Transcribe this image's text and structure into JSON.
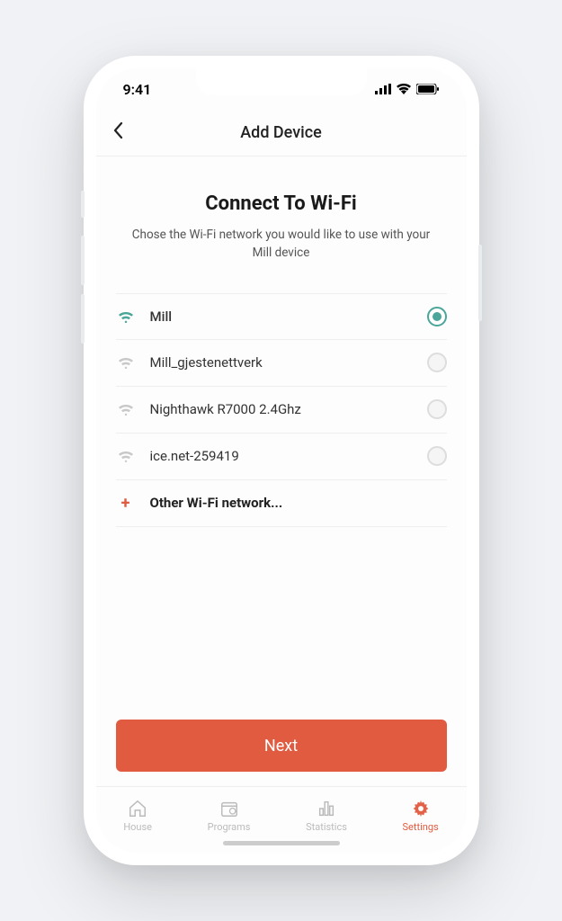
{
  "status": {
    "time": "9:41"
  },
  "header": {
    "title": "Add Device"
  },
  "page": {
    "heading": "Connect To Wi-Fi",
    "subheading": "Chose the Wi-Fi network you would like   to use with your Mill device"
  },
  "networks": [
    {
      "name": "Mill",
      "selected": true
    },
    {
      "name": "Mill_gjestenettverk",
      "selected": false
    },
    {
      "name": "Nighthawk R7000 2.4Ghz",
      "selected": false
    },
    {
      "name": "ice.net-259419",
      "selected": false
    }
  ],
  "other_label": "Other Wi-Fi network...",
  "next_button": "Next",
  "tabs": [
    {
      "label": "House"
    },
    {
      "label": "Programs"
    },
    {
      "label": "Statistics"
    },
    {
      "label": "Settings"
    }
  ],
  "colors": {
    "accent": "#e05b3f",
    "teal": "#4aa69a"
  }
}
